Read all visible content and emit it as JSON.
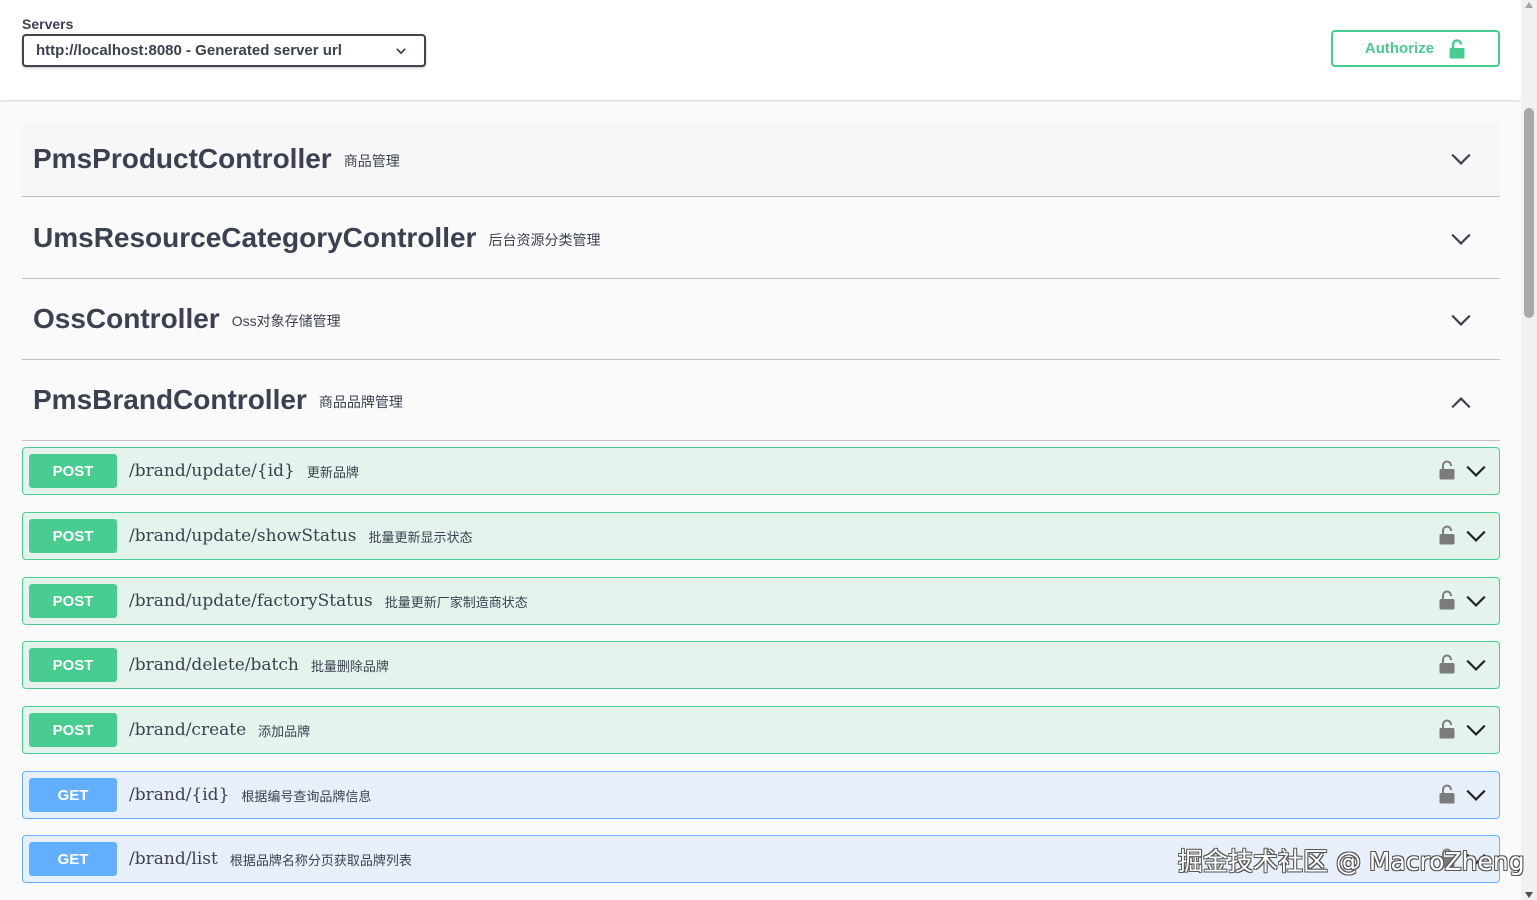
{
  "servers": {
    "label": "Servers",
    "selected": "http://localhost:8080 - Generated server url"
  },
  "authorize": {
    "label": "Authorize"
  },
  "tags": [
    {
      "name": "PmsProductController",
      "description": "商品管理",
      "expanded": false
    },
    {
      "name": "UmsResourceCategoryController",
      "description": "后台资源分类管理",
      "expanded": false
    },
    {
      "name": "OssController",
      "description": "Oss对象存储管理",
      "expanded": false
    },
    {
      "name": "PmsBrandController",
      "description": "商品品牌管理",
      "expanded": true
    }
  ],
  "operations": [
    {
      "method": "POST",
      "path": "/brand/update/{id}",
      "summary": "更新品牌"
    },
    {
      "method": "POST",
      "path": "/brand/update/showStatus",
      "summary": "批量更新显示状态"
    },
    {
      "method": "POST",
      "path": "/brand/update/factoryStatus",
      "summary": "批量更新厂家制造商状态"
    },
    {
      "method": "POST",
      "path": "/brand/delete/batch",
      "summary": "批量删除品牌"
    },
    {
      "method": "POST",
      "path": "/brand/create",
      "summary": "添加品牌"
    },
    {
      "method": "GET",
      "path": "/brand/{id}",
      "summary": "根据编号查询品牌信息"
    },
    {
      "method": "GET",
      "path": "/brand/list",
      "summary": "根据品牌名称分页获取品牌列表"
    }
  ],
  "watermark": "掘金技术社区 @ MacroZheng",
  "colors": {
    "post": "#49cc90",
    "get": "#61affe",
    "text": "#3b4151"
  },
  "icons": {
    "lock": "unlocked-lock-icon",
    "chevron_down": "chevron-down-icon",
    "chevron_up": "chevron-up-icon"
  }
}
